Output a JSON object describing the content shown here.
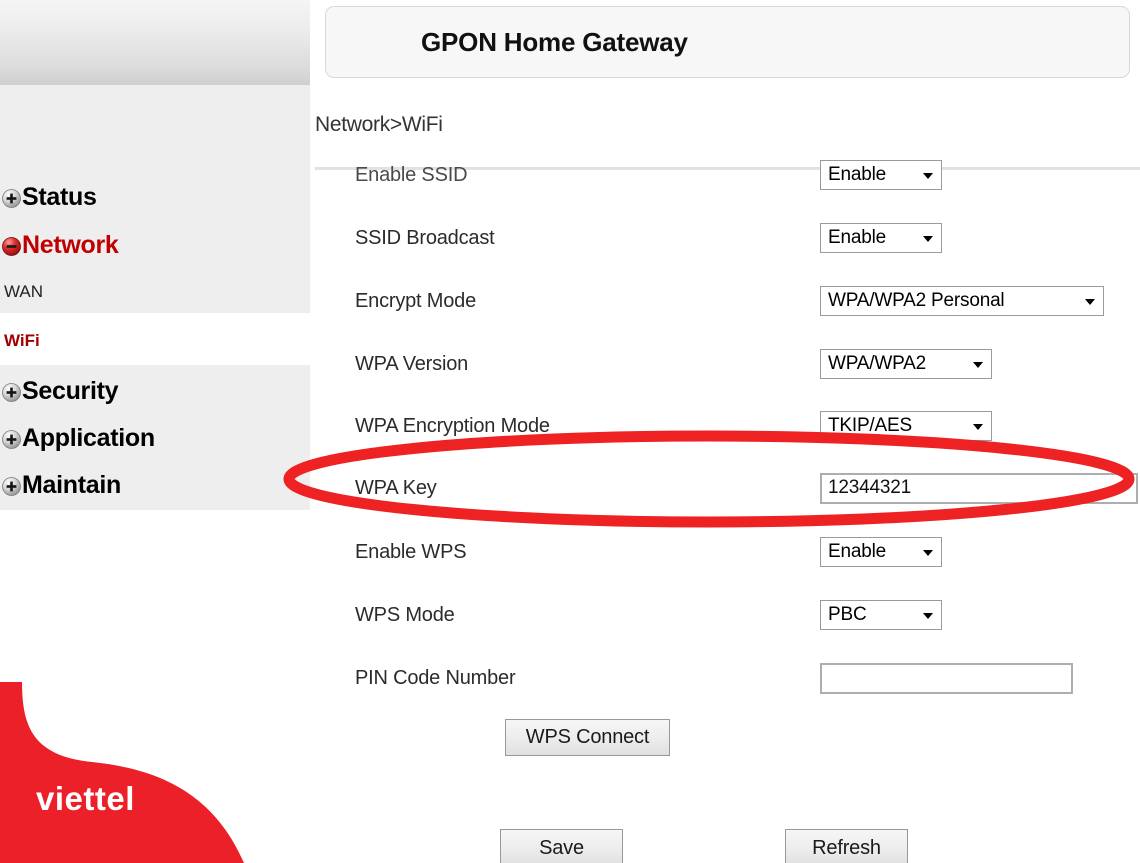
{
  "header": {
    "title": "GPON Home Gateway"
  },
  "breadcrumb": {
    "text": "Network>WiFi"
  },
  "sidebar": {
    "brand": "viettel",
    "items": [
      {
        "label": "Status",
        "icon": "plus-circle-icon",
        "state": "collapsed"
      },
      {
        "label": "Network",
        "icon": "minus-circle-icon",
        "state": "expanded"
      },
      {
        "label": "Security",
        "icon": "plus-circle-icon",
        "state": "collapsed"
      },
      {
        "label": "Application",
        "icon": "plus-circle-icon",
        "state": "collapsed"
      },
      {
        "label": "Maintain",
        "icon": "plus-circle-icon",
        "state": "collapsed"
      }
    ],
    "sub_items": [
      {
        "label": "WAN",
        "active": false
      },
      {
        "label": "WiFi",
        "active": true
      }
    ]
  },
  "form": {
    "rows": [
      {
        "label": "Enable SSID",
        "control": "select",
        "value": "Enable",
        "clipped": true
      },
      {
        "label": "SSID Broadcast",
        "control": "select",
        "value": "Enable",
        "clipped": false
      },
      {
        "label": "Encrypt Mode",
        "control": "select",
        "value": "WPA/WPA2 Personal",
        "clipped": false
      },
      {
        "label": "WPA Version",
        "control": "select",
        "value": "WPA/WPA2",
        "clipped": false
      },
      {
        "label": "WPA Encryption Mode",
        "control": "select",
        "value": "TKIP/AES",
        "clipped": false
      },
      {
        "label": "WPA Key",
        "control": "text",
        "value": "12344321",
        "clipped": false
      },
      {
        "label": "Enable WPS",
        "control": "select",
        "value": "Enable",
        "clipped": false
      },
      {
        "label": "WPS Mode",
        "control": "select",
        "value": "PBC",
        "clipped": false
      },
      {
        "label": "PIN Code Number",
        "control": "text",
        "value": "",
        "clipped": false
      }
    ]
  },
  "buttons": {
    "wps_connect": "WPS Connect",
    "save": "Save",
    "refresh": "Refresh"
  },
  "colors": {
    "brand_red": "#ec2028",
    "accent_red": "#c00000",
    "active_red": "#a00000",
    "annotation_red": "#ee2222",
    "sidebar_bg": "#eeeeee",
    "panel_bg": "#f7f7f7"
  }
}
